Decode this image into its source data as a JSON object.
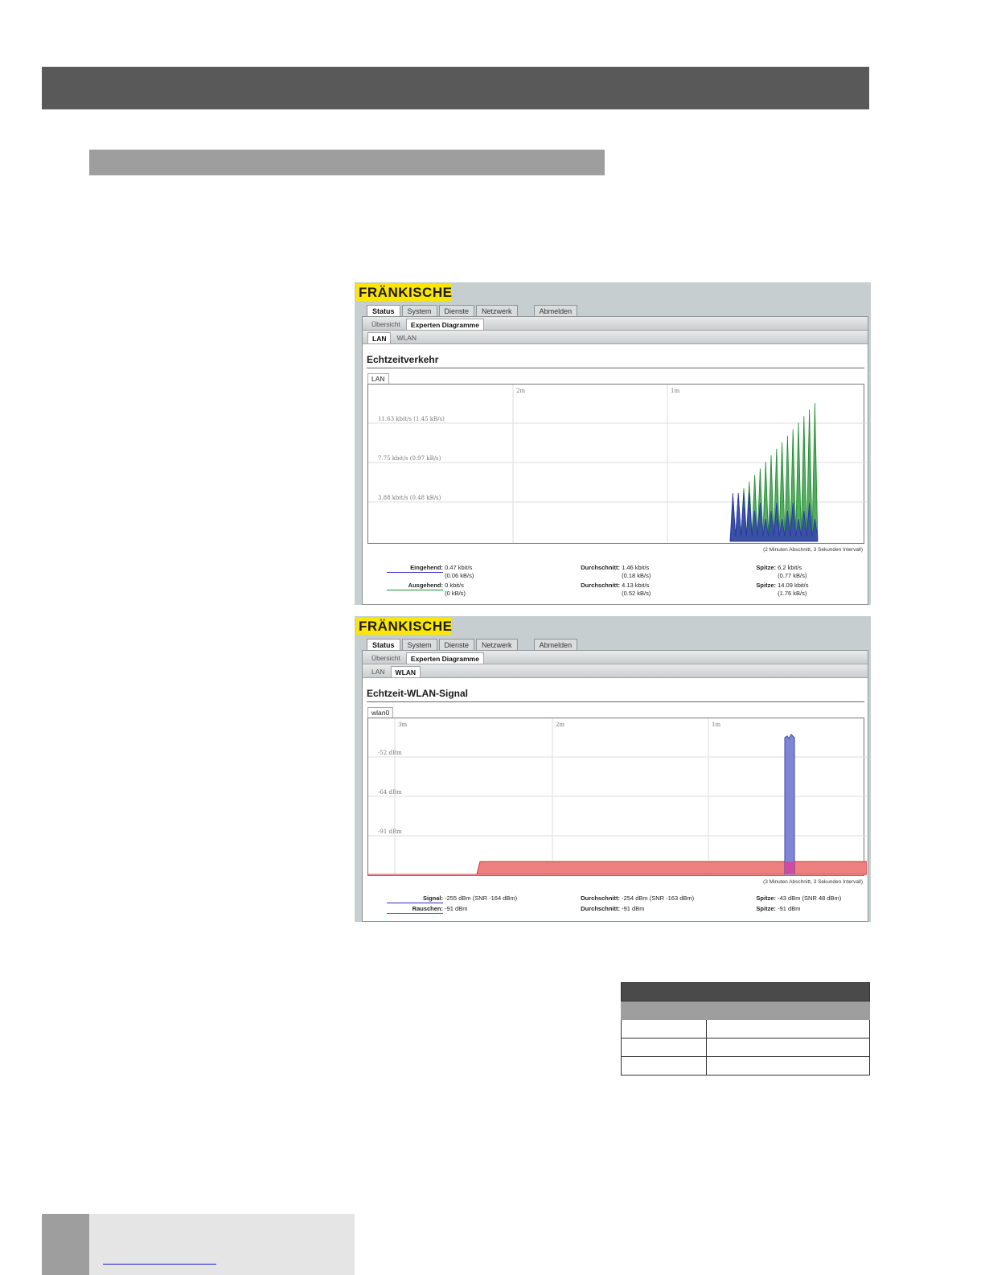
{
  "screens": [
    {
      "logo": "FRÄNKISCHE",
      "main_tabs": [
        "Status",
        "System",
        "Dienste",
        "Netzwerk"
      ],
      "logout": "Abmelden",
      "sub_tabs": [
        "Übersicht",
        "Experten Diagramme"
      ],
      "third_tabs": [
        "LAN",
        "WLAN"
      ],
      "active_third": "LAN",
      "heading": "Echtzeitverkehr",
      "graph_tab": "LAN",
      "time_labels": [
        "2m",
        "1m"
      ],
      "y_labels": [
        "11.63 kbit/s (1.45 kB/s)",
        "7.75 kbit/s (0.97 kB/s)",
        "3.88 kbit/s (0.48 kB/s)"
      ],
      "interval_note": "(2 Minuten Abschnitt, 3 Sekunden Intervall)",
      "stats": {
        "in_label": "Eingehend:",
        "in_value": "0.47 kbit/s",
        "in_value2": "(0.06 kB/s)",
        "in_avg_label": "Durchschnitt:",
        "in_avg": "1.46 kbit/s",
        "in_avg2": "(0.18 kB/s)",
        "in_peak_label": "Spitze:",
        "in_peak": "6.2 kbit/s",
        "in_peak2": "(0.77 kB/s)",
        "out_label": "Ausgehend:",
        "out_value": "0 kbit/s",
        "out_value2": "(0 kB/s)",
        "out_avg_label": "Durchschnitt:",
        "out_avg": "4.13 kbit/s",
        "out_avg2": "(0.52 kB/s)",
        "out_peak_label": "Spitze:",
        "out_peak": "14.09 kbit/s",
        "out_peak2": "(1.76 kB/s)"
      },
      "colors": {
        "incoming": "#2d2dbd",
        "outgoing": "#1e8e2e",
        "fill": "#1a9e8e"
      }
    },
    {
      "logo": "FRÄNKISCHE",
      "main_tabs": [
        "Status",
        "System",
        "Dienste",
        "Netzwerk"
      ],
      "logout": "Abmelden",
      "sub_tabs": [
        "Übersicht",
        "Experten Diagramme"
      ],
      "third_tabs": [
        "LAN",
        "WLAN"
      ],
      "active_third": "WLAN",
      "heading": "Echtzeit-WLAN-Signal",
      "graph_tab": "wlan0",
      "time_labels": [
        "3m",
        "2m",
        "1m"
      ],
      "y_labels": [
        "-52 dBm",
        "-64 dBm",
        "-91 dBm"
      ],
      "interval_note": "(3 Minuten Abschnitt, 3 Sekunden Intervall)",
      "stats": {
        "sig_label": "Signal:",
        "sig_value": "-255 dBm (SNR -164 dBm)",
        "sig_avg_label": "Durchschnitt:",
        "sig_avg": "-254 dBm (SNR -163 dBm)",
        "sig_peak_label": "Spitze:",
        "sig_peak": "-43 dBm (SNR 48 dBm)",
        "noise_label": "Rauschen:",
        "noise_value": "-91 dBm",
        "noise_avg_label": "Durchschnitt:",
        "noise_avg": "-91 dBm",
        "noise_peak_label": "Spitze:",
        "noise_peak": "-91 dBm"
      },
      "colors": {
        "signal": "#7f87d4",
        "noise": "#f08080"
      }
    }
  ]
}
